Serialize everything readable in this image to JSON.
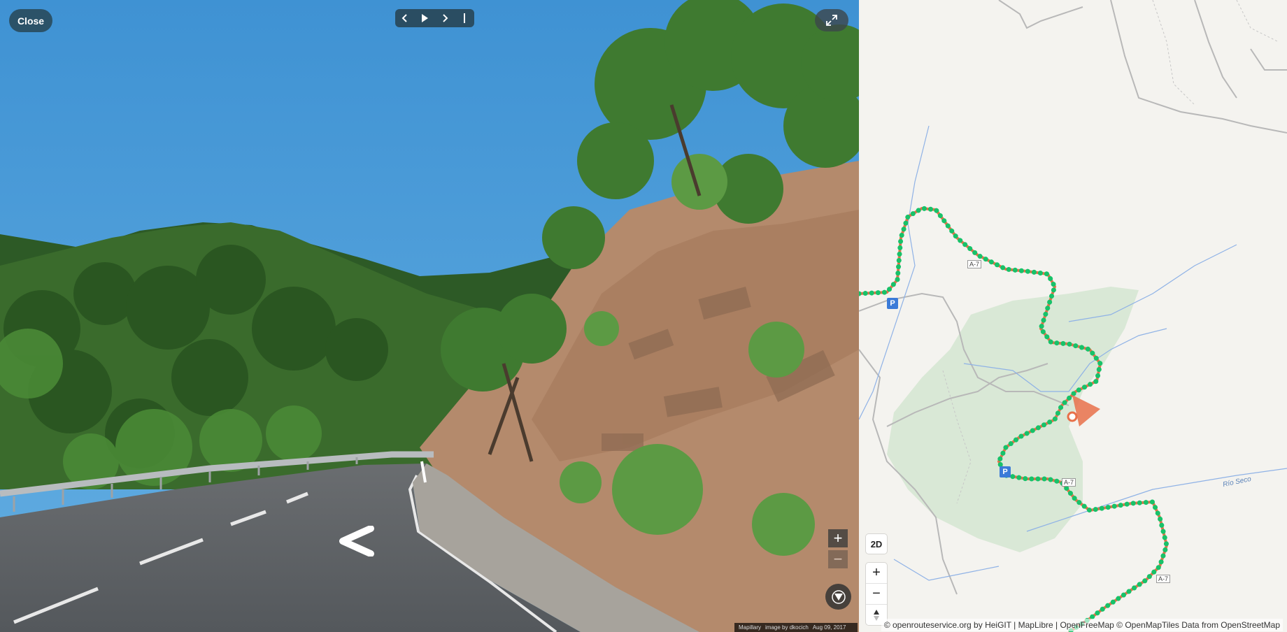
{
  "viewer": {
    "close_label": "Close",
    "nav": {
      "prev_icon": "chevron-left-icon",
      "play_icon": "play-icon",
      "next_icon": "chevron-right-icon",
      "end_icon": "pipe-icon"
    },
    "expand_icon": "expand-icon",
    "zoom_in": "+",
    "zoom_out": "−",
    "compass_icon": "compass-icon",
    "attribution": {
      "brand": "Mapillary",
      "credit": "image by dkocich",
      "date": "Aug 09, 2017"
    }
  },
  "map": {
    "mode_label": "2D",
    "zoom_in": "+",
    "zoom_out": "−",
    "north_icon": "compass-north-icon",
    "attribution": "© openrouteservice.org by HeiGIT | MapLibre | OpenFreeMap © OpenMapTiles Data from OpenStreetMap",
    "river_label": "Río Seco",
    "parking_label": "P",
    "road_label": "A-7",
    "colors": {
      "route": "#17c269",
      "route_casing": "#ffffff",
      "path": "#e8704a",
      "marker": "#e8704a",
      "forest": "#d9e8d6",
      "water": "#8fb2e6",
      "background": "#f4f3ef"
    }
  }
}
